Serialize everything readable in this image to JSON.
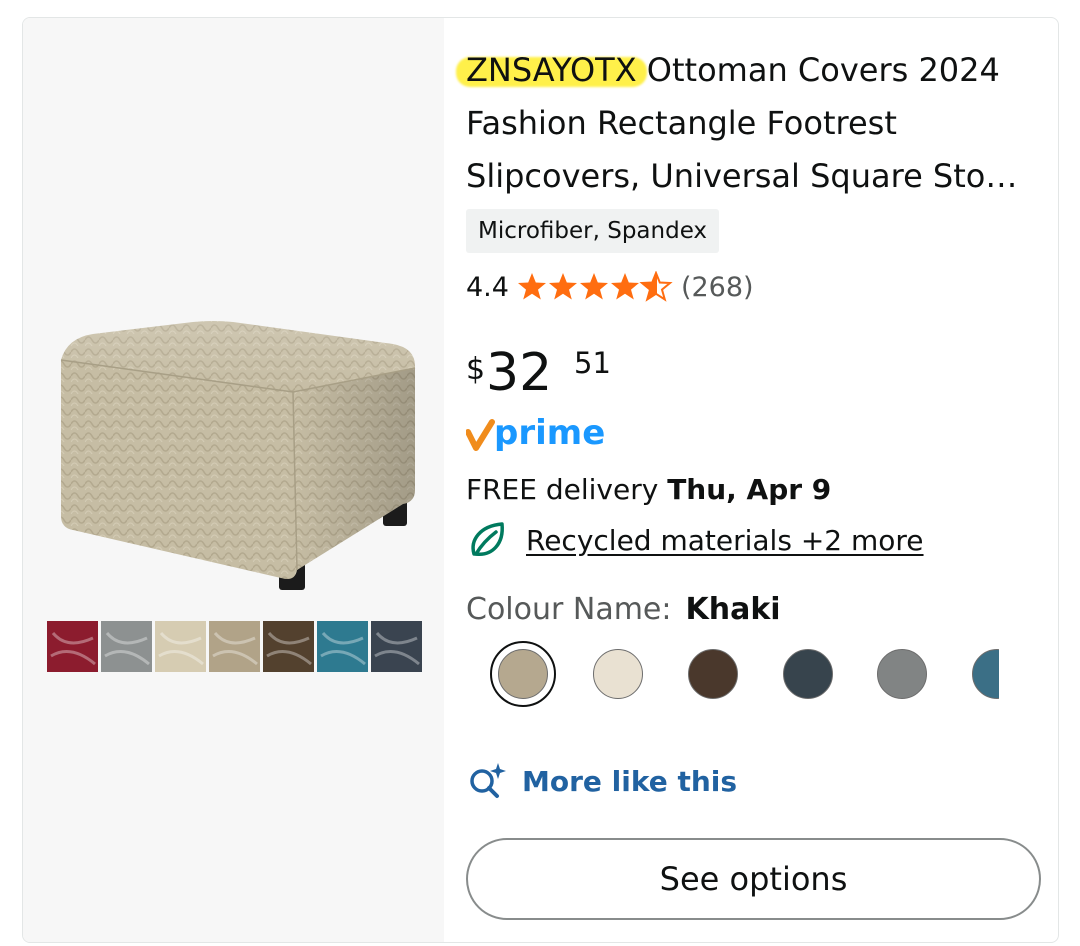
{
  "product": {
    "brand": "ZNSAYOTX",
    "title_rest": " Ottoman Covers 2024 Fashion Rectangle Footrest Slipcovers, Universal Square Sto…",
    "material": "Microfiber, Spandex",
    "rating": "4.4",
    "rating_count": "(268)",
    "price_symbol": "$",
    "price_whole": "32",
    "price_fraction": "51",
    "prime_label": "prime",
    "delivery_prefix": "FREE delivery ",
    "delivery_date": "Thu, Apr 9",
    "sustainability_link": "Recycled materials +2 more",
    "colour_label": "Colour Name:",
    "colour_value": "Khaki",
    "more_like_label": "More like this",
    "see_options_label": "See options"
  },
  "swatches": [
    {
      "name": "khaki",
      "color": "#b5a88f",
      "selected": true
    },
    {
      "name": "cream",
      "color": "#e9e1d2"
    },
    {
      "name": "brown",
      "color": "#4a382c"
    },
    {
      "name": "dark-slate",
      "color": "#37444d"
    },
    {
      "name": "grey",
      "color": "#818484"
    },
    {
      "name": "teal",
      "color": "#3b6f86"
    }
  ],
  "thumbnail_colors": [
    "#8c1c2e",
    "#8d9191",
    "#d6ccb2",
    "#b1a388",
    "#53412e",
    "#2e7a90",
    "#3a4450"
  ],
  "colors": {
    "highlight": "#fff04a",
    "star": "#ff6d10",
    "prime_blue": "#1a98ff",
    "prime_check": "#f08c1c",
    "link_blue": "#2162a1",
    "leaf_green": "#007a5e"
  },
  "icons": {
    "star": "star-icon",
    "prime_check": "prime-check-icon",
    "leaf": "leaf-icon",
    "search_sparkle": "search-sparkle-icon"
  }
}
